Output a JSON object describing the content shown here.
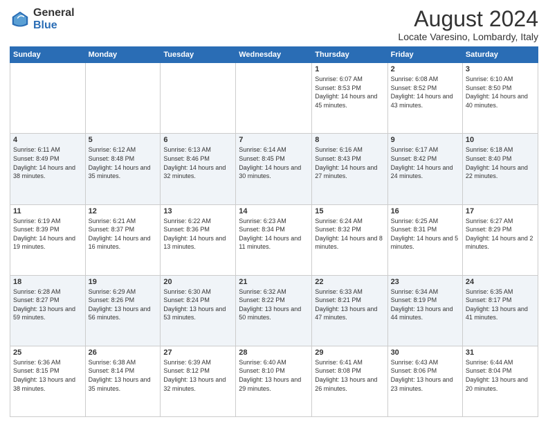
{
  "logo": {
    "general": "General",
    "blue": "Blue"
  },
  "title": "August 2024",
  "location": "Locate Varesino, Lombardy, Italy",
  "days_of_week": [
    "Sunday",
    "Monday",
    "Tuesday",
    "Wednesday",
    "Thursday",
    "Friday",
    "Saturday"
  ],
  "weeks": [
    [
      {
        "day": "",
        "info": ""
      },
      {
        "day": "",
        "info": ""
      },
      {
        "day": "",
        "info": ""
      },
      {
        "day": "",
        "info": ""
      },
      {
        "day": "1",
        "info": "Sunrise: 6:07 AM\nSunset: 8:53 PM\nDaylight: 14 hours and 45 minutes."
      },
      {
        "day": "2",
        "info": "Sunrise: 6:08 AM\nSunset: 8:52 PM\nDaylight: 14 hours and 43 minutes."
      },
      {
        "day": "3",
        "info": "Sunrise: 6:10 AM\nSunset: 8:50 PM\nDaylight: 14 hours and 40 minutes."
      }
    ],
    [
      {
        "day": "4",
        "info": "Sunrise: 6:11 AM\nSunset: 8:49 PM\nDaylight: 14 hours and 38 minutes."
      },
      {
        "day": "5",
        "info": "Sunrise: 6:12 AM\nSunset: 8:48 PM\nDaylight: 14 hours and 35 minutes."
      },
      {
        "day": "6",
        "info": "Sunrise: 6:13 AM\nSunset: 8:46 PM\nDaylight: 14 hours and 32 minutes."
      },
      {
        "day": "7",
        "info": "Sunrise: 6:14 AM\nSunset: 8:45 PM\nDaylight: 14 hours and 30 minutes."
      },
      {
        "day": "8",
        "info": "Sunrise: 6:16 AM\nSunset: 8:43 PM\nDaylight: 14 hours and 27 minutes."
      },
      {
        "day": "9",
        "info": "Sunrise: 6:17 AM\nSunset: 8:42 PM\nDaylight: 14 hours and 24 minutes."
      },
      {
        "day": "10",
        "info": "Sunrise: 6:18 AM\nSunset: 8:40 PM\nDaylight: 14 hours and 22 minutes."
      }
    ],
    [
      {
        "day": "11",
        "info": "Sunrise: 6:19 AM\nSunset: 8:39 PM\nDaylight: 14 hours and 19 minutes."
      },
      {
        "day": "12",
        "info": "Sunrise: 6:21 AM\nSunset: 8:37 PM\nDaylight: 14 hours and 16 minutes."
      },
      {
        "day": "13",
        "info": "Sunrise: 6:22 AM\nSunset: 8:36 PM\nDaylight: 14 hours and 13 minutes."
      },
      {
        "day": "14",
        "info": "Sunrise: 6:23 AM\nSunset: 8:34 PM\nDaylight: 14 hours and 11 minutes."
      },
      {
        "day": "15",
        "info": "Sunrise: 6:24 AM\nSunset: 8:32 PM\nDaylight: 14 hours and 8 minutes."
      },
      {
        "day": "16",
        "info": "Sunrise: 6:25 AM\nSunset: 8:31 PM\nDaylight: 14 hours and 5 minutes."
      },
      {
        "day": "17",
        "info": "Sunrise: 6:27 AM\nSunset: 8:29 PM\nDaylight: 14 hours and 2 minutes."
      }
    ],
    [
      {
        "day": "18",
        "info": "Sunrise: 6:28 AM\nSunset: 8:27 PM\nDaylight: 13 hours and 59 minutes."
      },
      {
        "day": "19",
        "info": "Sunrise: 6:29 AM\nSunset: 8:26 PM\nDaylight: 13 hours and 56 minutes."
      },
      {
        "day": "20",
        "info": "Sunrise: 6:30 AM\nSunset: 8:24 PM\nDaylight: 13 hours and 53 minutes."
      },
      {
        "day": "21",
        "info": "Sunrise: 6:32 AM\nSunset: 8:22 PM\nDaylight: 13 hours and 50 minutes."
      },
      {
        "day": "22",
        "info": "Sunrise: 6:33 AM\nSunset: 8:21 PM\nDaylight: 13 hours and 47 minutes."
      },
      {
        "day": "23",
        "info": "Sunrise: 6:34 AM\nSunset: 8:19 PM\nDaylight: 13 hours and 44 minutes."
      },
      {
        "day": "24",
        "info": "Sunrise: 6:35 AM\nSunset: 8:17 PM\nDaylight: 13 hours and 41 minutes."
      }
    ],
    [
      {
        "day": "25",
        "info": "Sunrise: 6:36 AM\nSunset: 8:15 PM\nDaylight: 13 hours and 38 minutes."
      },
      {
        "day": "26",
        "info": "Sunrise: 6:38 AM\nSunset: 8:14 PM\nDaylight: 13 hours and 35 minutes."
      },
      {
        "day": "27",
        "info": "Sunrise: 6:39 AM\nSunset: 8:12 PM\nDaylight: 13 hours and 32 minutes."
      },
      {
        "day": "28",
        "info": "Sunrise: 6:40 AM\nSunset: 8:10 PM\nDaylight: 13 hours and 29 minutes."
      },
      {
        "day": "29",
        "info": "Sunrise: 6:41 AM\nSunset: 8:08 PM\nDaylight: 13 hours and 26 minutes."
      },
      {
        "day": "30",
        "info": "Sunrise: 6:43 AM\nSunset: 8:06 PM\nDaylight: 13 hours and 23 minutes."
      },
      {
        "day": "31",
        "info": "Sunrise: 6:44 AM\nSunset: 8:04 PM\nDaylight: 13 hours and 20 minutes."
      }
    ]
  ]
}
